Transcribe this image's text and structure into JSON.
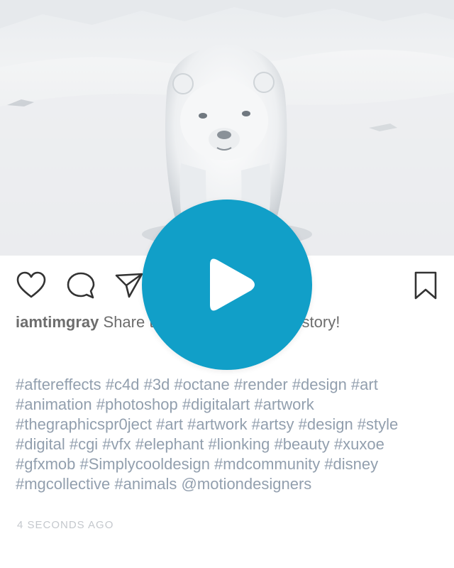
{
  "post": {
    "username": "iamtimgray",
    "caption": "Share this post to your Insta story!",
    "hashtags": "#aftereffects #c4d #3d #octane #render #design #art #animation #photoshop #digitalart #artwork #thegraphicspr0ject #art #artwork #artsy #design #style #digital #cgi #vfx #elephant #lionking #beauty #xuxoe #gfxmob #Simplycooldesign #mdcommunity #disney #mgcollective #animals @motiondesigners",
    "timestamp": "4 SECONDS AGO"
  },
  "icons": {
    "like": "heart-icon",
    "comment": "comment-icon",
    "share": "send-icon",
    "save": "bookmark-icon",
    "play": "play-icon"
  },
  "colors": {
    "play_button": "#119fc8",
    "hashtags": "#929fae",
    "caption_text": "#6d6d6d",
    "timestamp": "#c4c8cd"
  }
}
